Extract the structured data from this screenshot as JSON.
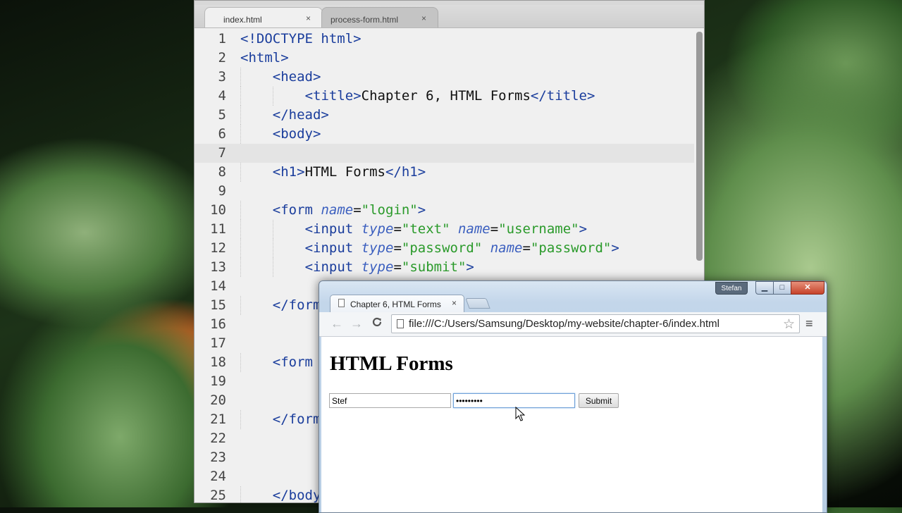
{
  "editor": {
    "tabs": [
      {
        "label": "index.html",
        "close": "×"
      },
      {
        "label": "process-form.html",
        "close": "×"
      }
    ],
    "lines": [
      {
        "n": "1",
        "indent": 0,
        "parts": [
          [
            "tg",
            "<!DOCTYPE html>"
          ]
        ]
      },
      {
        "n": "2",
        "indent": 0,
        "parts": [
          [
            "tg",
            "<html>"
          ]
        ]
      },
      {
        "n": "3",
        "indent": 1,
        "parts": [
          [
            "tg",
            "<head>"
          ]
        ]
      },
      {
        "n": "4",
        "indent": 2,
        "parts": [
          [
            "tg",
            "<title>"
          ],
          [
            "tx",
            "Chapter 6, HTML Forms"
          ],
          [
            "tg",
            "</title>"
          ]
        ]
      },
      {
        "n": "5",
        "indent": 1,
        "parts": [
          [
            "tg",
            "</head>"
          ]
        ]
      },
      {
        "n": "6",
        "indent": 1,
        "parts": [
          [
            "tg",
            "<body>"
          ]
        ]
      },
      {
        "n": "7",
        "indent": 0,
        "parts": []
      },
      {
        "n": "8",
        "indent": 1,
        "parts": [
          [
            "tg",
            "<h1>"
          ],
          [
            "tx",
            "HTML Forms"
          ],
          [
            "tg",
            "</h1>"
          ]
        ]
      },
      {
        "n": "9",
        "indent": 0,
        "parts": []
      },
      {
        "n": "10",
        "indent": 1,
        "parts": [
          [
            "tg",
            "<form "
          ],
          [
            "at",
            "name"
          ],
          [
            "tx",
            "="
          ],
          [
            "st",
            "\"login\""
          ],
          [
            "tg",
            ">"
          ]
        ]
      },
      {
        "n": "11",
        "indent": 2,
        "parts": [
          [
            "tg",
            "<input "
          ],
          [
            "at",
            "type"
          ],
          [
            "tx",
            "="
          ],
          [
            "st",
            "\"text\" "
          ],
          [
            "at",
            "name"
          ],
          [
            "tx",
            "="
          ],
          [
            "st",
            "\"username\""
          ],
          [
            "tg",
            ">"
          ]
        ]
      },
      {
        "n": "12",
        "indent": 2,
        "parts": [
          [
            "tg",
            "<input "
          ],
          [
            "at",
            "type"
          ],
          [
            "tx",
            "="
          ],
          [
            "st",
            "\"password\" "
          ],
          [
            "at",
            "name"
          ],
          [
            "tx",
            "="
          ],
          [
            "st",
            "\"password\""
          ],
          [
            "tg",
            ">"
          ]
        ]
      },
      {
        "n": "13",
        "indent": 2,
        "parts": [
          [
            "tg",
            "<input "
          ],
          [
            "at",
            "type"
          ],
          [
            "tx",
            "="
          ],
          [
            "st",
            "\"submit\""
          ],
          [
            "tg",
            ">"
          ]
        ]
      },
      {
        "n": "14",
        "indent": 0,
        "parts": []
      },
      {
        "n": "15",
        "indent": 1,
        "parts": [
          [
            "tg",
            "</form>"
          ]
        ]
      },
      {
        "n": "16",
        "indent": 0,
        "parts": []
      },
      {
        "n": "17",
        "indent": 0,
        "parts": []
      },
      {
        "n": "18",
        "indent": 1,
        "parts": [
          [
            "tg",
            "<form"
          ]
        ]
      },
      {
        "n": "19",
        "indent": 0,
        "parts": []
      },
      {
        "n": "20",
        "indent": 0,
        "parts": []
      },
      {
        "n": "21",
        "indent": 1,
        "parts": [
          [
            "tg",
            "</form>"
          ]
        ]
      },
      {
        "n": "22",
        "indent": 0,
        "parts": []
      },
      {
        "n": "23",
        "indent": 0,
        "parts": []
      },
      {
        "n": "24",
        "indent": 0,
        "parts": []
      },
      {
        "n": "25",
        "indent": 1,
        "parts": [
          [
            "tg",
            "</body>"
          ]
        ]
      }
    ],
    "current_line": "7"
  },
  "browser": {
    "profile": "Stefan",
    "window_buttons": {
      "min": "▁",
      "max": "□",
      "close": "✕"
    },
    "tab_title": "Chapter 6, HTML Forms",
    "tab_close": "×",
    "nav": {
      "back": "←",
      "forward": "→",
      "reload": "C"
    },
    "url": "file:///C:/Users/Samsung/Desktop/my-website/chapter-6/index.html",
    "star": "☆",
    "menu": "≡",
    "page": {
      "heading": "HTML Forms",
      "username_value": "Stef",
      "password_value": "•••••••••",
      "submit_label": "Submit"
    }
  },
  "colors": {
    "tag": "#1a3d9c",
    "attr": "#3b5fbf",
    "string": "#2a9a2a"
  }
}
